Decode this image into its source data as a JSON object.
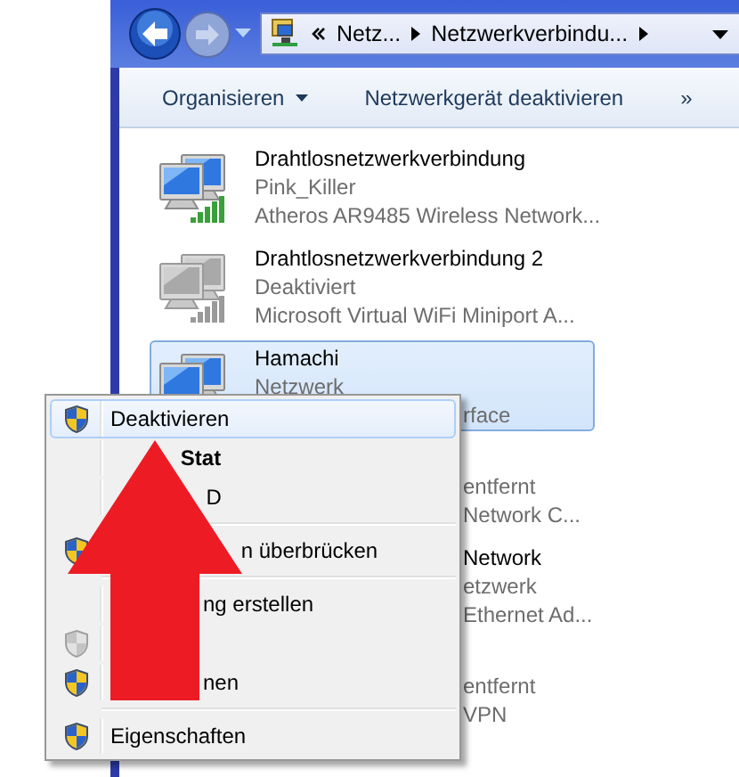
{
  "address_bar": {
    "segments": [
      "Netz...",
      "Netzwerkverbindu..."
    ]
  },
  "toolbar": [
    {
      "label": "Organisieren",
      "dropdown": true
    },
    {
      "label": "Netzwerkgerät deaktivieren",
      "dropdown": false
    },
    {
      "label": "»",
      "dropdown": false
    }
  ],
  "connections": [
    {
      "kind": "wireless",
      "name": "Drahtlosnetzwerkverbindung",
      "status": "Pink_Killer",
      "device": "Atheros AR9485 Wireless Network...",
      "enabled": true,
      "selected": false,
      "device_covered": false
    },
    {
      "kind": "wireless",
      "name": "Drahtlosnetzwerkverbindung 2",
      "status": "Deaktiviert",
      "device": "Microsoft Virtual WiFi Miniport A...",
      "enabled": false,
      "selected": false,
      "device_covered": false
    },
    {
      "kind": "wired",
      "name": "Hamachi",
      "status": "Netzwerk",
      "device": "rface",
      "enabled": true,
      "selected": true,
      "device_covered": true
    },
    {
      "kind": "covered",
      "status": "entfernt",
      "device": "Network C...",
      "selected": false
    },
    {
      "kind": "covered",
      "name": "Network",
      "status": "etzwerk",
      "device": "Ethernet Ad...",
      "selected": false
    },
    {
      "kind": "covered",
      "status": "entfernt",
      "device": "VPN",
      "selected": false
    }
  ],
  "context_menu": [
    {
      "kind": "item",
      "label": "Deaktivieren",
      "shield": true,
      "highlighted": true,
      "default": false,
      "disabled": false
    },
    {
      "kind": "item",
      "label": "Stat",
      "shield": false,
      "highlighted": false,
      "default": true,
      "disabled": false
    },
    {
      "kind": "item",
      "label": "D",
      "shield": false,
      "highlighted": false,
      "default": false,
      "disabled": false
    },
    {
      "kind": "separator"
    },
    {
      "kind": "item",
      "label": "n überbrücken",
      "shield": true,
      "highlighted": false,
      "default": false,
      "disabled": false
    },
    {
      "kind": "separator"
    },
    {
      "kind": "item",
      "label": "ng erstellen",
      "shield": false,
      "highlighted": false,
      "default": false,
      "disabled": false
    },
    {
      "kind": "item",
      "shield": true,
      "highlighted": false,
      "disabled": true
    },
    {
      "kind": "item",
      "label": "nen",
      "shield": true,
      "highlighted": false,
      "default": false,
      "disabled": false
    },
    {
      "kind": "separator"
    },
    {
      "kind": "item",
      "label": "Eigenschaften",
      "shield": true,
      "highlighted": false,
      "default": false,
      "disabled": false
    }
  ]
}
